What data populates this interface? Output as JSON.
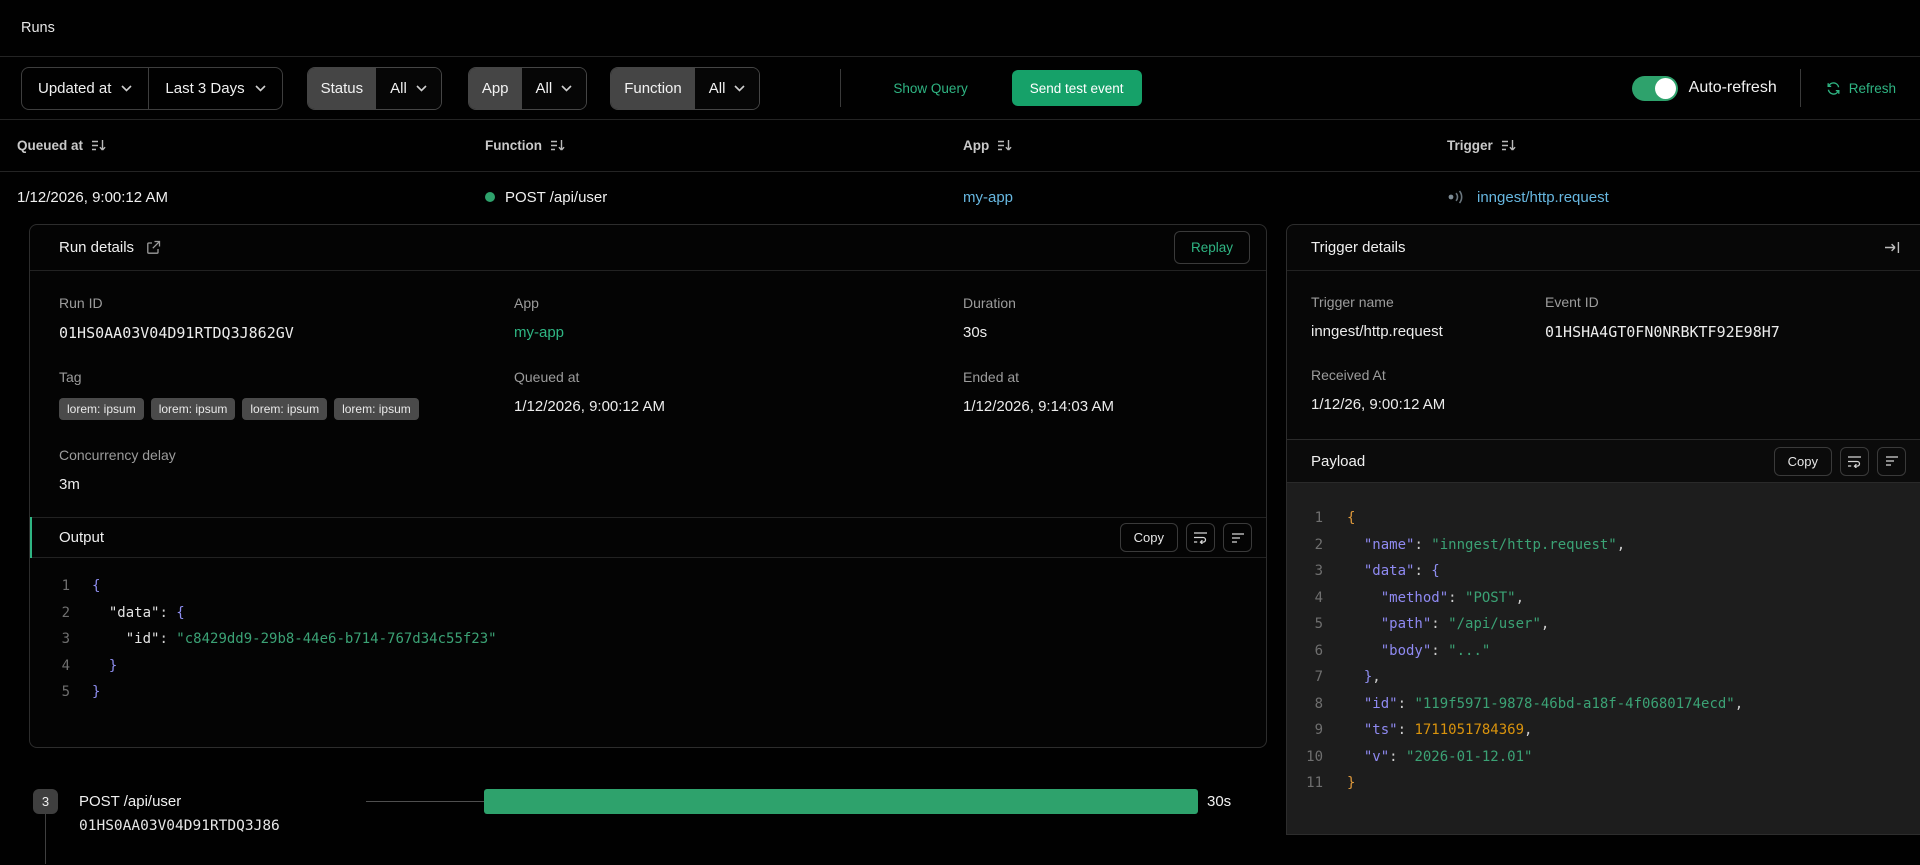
{
  "page": {
    "title": "Runs"
  },
  "filters": {
    "sort_field": "Updated at",
    "time_range": "Last 3 Days",
    "status_label": "Status",
    "status_value": "All",
    "app_label": "App",
    "app_value": "All",
    "function_label": "Function",
    "function_value": "All",
    "show_query": "Show Query",
    "send_test_event": "Send test event",
    "auto_refresh": "Auto-refresh",
    "refresh": "Refresh"
  },
  "table": {
    "columns": {
      "queued_at": "Queued at",
      "function": "Function",
      "app": "App",
      "trigger": "Trigger"
    },
    "row": {
      "queued_at": "1/12/2026, 9:00:12 AM",
      "function": "POST /api/user",
      "app": "my-app",
      "trigger": "inngest/http.request"
    }
  },
  "run_details": {
    "title": "Run details",
    "replay_label": "Replay",
    "run_id_label": "Run ID",
    "run_id": "01HS0AA03V04D91RTDQ3J862GV",
    "app_label": "App",
    "app": "my-app",
    "duration_label": "Duration",
    "duration": "30s",
    "tag_label": "Tag",
    "tags": [
      "lorem: ipsum",
      "lorem: ipsum",
      "lorem: ipsum",
      "lorem: ipsum"
    ],
    "queued_at_label": "Queued at",
    "queued_at": "1/12/2026, 9:00:12 AM",
    "ended_at_label": "Ended at",
    "ended_at": "1/12/2026, 9:14:03 AM",
    "concurrency_label": "Concurrency delay",
    "concurrency": "3m",
    "output": {
      "title": "Output",
      "copy_label": "Copy",
      "code": [
        {
          "n": "1",
          "t": [
            [
              "brp",
              "{"
            ]
          ]
        },
        {
          "n": "2",
          "t": [
            [
              "kw",
              "  \"data\""
            ],
            [
              "pl",
              ": "
            ],
            [
              "brp",
              "{"
            ]
          ]
        },
        {
          "n": "3",
          "t": [
            [
              "kw",
              "    \"id\""
            ],
            [
              "pl",
              ": "
            ],
            [
              "s",
              "\"c8429dd9-29b8-44e6-b714-767d34c55f23\""
            ]
          ]
        },
        {
          "n": "4",
          "t": [
            [
              "brp",
              "  }"
            ]
          ]
        },
        {
          "n": "5",
          "t": [
            [
              "brp",
              "}"
            ]
          ]
        }
      ]
    }
  },
  "timeline": {
    "badge": "3",
    "step_name": "POST /api/user",
    "step_id": "01HS0AA03V04D91RTDQ3J86",
    "duration": "30s"
  },
  "trigger_details": {
    "title": "Trigger details",
    "trigger_name_label": "Trigger name",
    "trigger_name": "inngest/http.request",
    "event_id_label": "Event ID",
    "event_id": "01HSHA4GT0FN0NRBKTF92E98H7",
    "received_at_label": "Received At",
    "received_at": "1/12/26, 9:00:12 AM",
    "payload": {
      "title": "Payload",
      "copy_label": "Copy",
      "code": [
        {
          "n": "1",
          "t": [
            [
              "bro",
              "{"
            ]
          ]
        },
        {
          "n": "2",
          "t": [
            [
              "kp",
              "  \"name\""
            ],
            [
              "pl",
              ": "
            ],
            [
              "s",
              "\"inngest/http.request\""
            ],
            [
              "pl",
              ","
            ]
          ]
        },
        {
          "n": "3",
          "t": [
            [
              "kp",
              "  \"data\""
            ],
            [
              "pl",
              ": "
            ],
            [
              "brp",
              "{"
            ]
          ]
        },
        {
          "n": "4",
          "t": [
            [
              "kp",
              "    \"method\""
            ],
            [
              "pl",
              ": "
            ],
            [
              "s",
              "\"POST\""
            ],
            [
              "pl",
              ","
            ]
          ]
        },
        {
          "n": "5",
          "t": [
            [
              "kp",
              "    \"path\""
            ],
            [
              "pl",
              ": "
            ],
            [
              "s",
              "\"/api/user\""
            ],
            [
              "pl",
              ","
            ]
          ]
        },
        {
          "n": "6",
          "t": [
            [
              "kp",
              "    \"body\""
            ],
            [
              "pl",
              ": "
            ],
            [
              "s",
              "\"...\""
            ]
          ]
        },
        {
          "n": "7",
          "t": [
            [
              "brp",
              "  }"
            ],
            [
              "pl",
              ","
            ]
          ]
        },
        {
          "n": "8",
          "t": [
            [
              "kp",
              "  \"id\""
            ],
            [
              "pl",
              ": "
            ],
            [
              "s",
              "\"119f5971-9878-46bd-a18f-4f0680174ecd\""
            ],
            [
              "pl",
              ","
            ]
          ]
        },
        {
          "n": "9",
          "t": [
            [
              "kp",
              "  \"ts\""
            ],
            [
              "pl",
              ": "
            ],
            [
              "num",
              "1711051784369"
            ],
            [
              "pl",
              ","
            ]
          ]
        },
        {
          "n": "10",
          "t": [
            [
              "kp",
              "  \"v\""
            ],
            [
              "pl",
              ": "
            ],
            [
              "s",
              "\"2026-01-12.01\""
            ]
          ]
        },
        {
          "n": "11",
          "t": [
            [
              "bro",
              "}"
            ]
          ]
        }
      ]
    }
  },
  "colors": {
    "accent_green": "#16a169",
    "bar_green": "#2ea26c",
    "text_green": "#2fb583",
    "link_blue": "#67b7e0"
  }
}
